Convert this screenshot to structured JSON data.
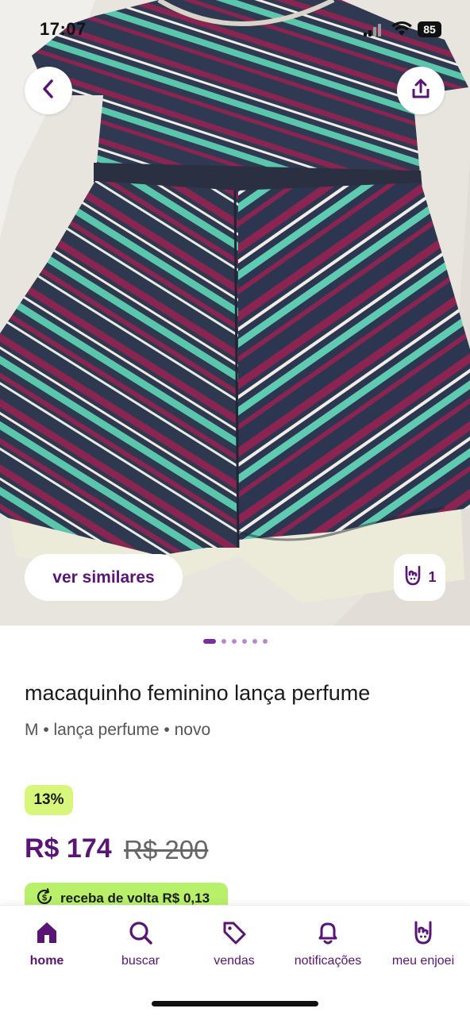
{
  "status_bar": {
    "time": "17:07",
    "battery": "85"
  },
  "product": {
    "similar_label": "ver similares",
    "likes": "1",
    "title": "macaquinho feminino lança perfume",
    "meta": "M • lança perfume • novo",
    "discount": "13%",
    "price": "R$ 174",
    "old_price": "R$ 200",
    "cashback": "receba de volta R$ 0,13",
    "photo_count": 6,
    "photo_index": 1
  },
  "nav": {
    "items": [
      {
        "label": "home",
        "icon": "home-icon",
        "active": true
      },
      {
        "label": "buscar",
        "icon": "search-icon",
        "active": false
      },
      {
        "label": "vendas",
        "icon": "tag-icon",
        "active": false
      },
      {
        "label": "notificações",
        "icon": "bell-icon",
        "active": false
      },
      {
        "label": "meu enjoei",
        "icon": "rock-hand-icon",
        "active": false
      }
    ]
  },
  "colors": {
    "brand_purple": "#5a1475",
    "discount_green": "#d8f77a",
    "cashback_green": "#b8f06a"
  }
}
